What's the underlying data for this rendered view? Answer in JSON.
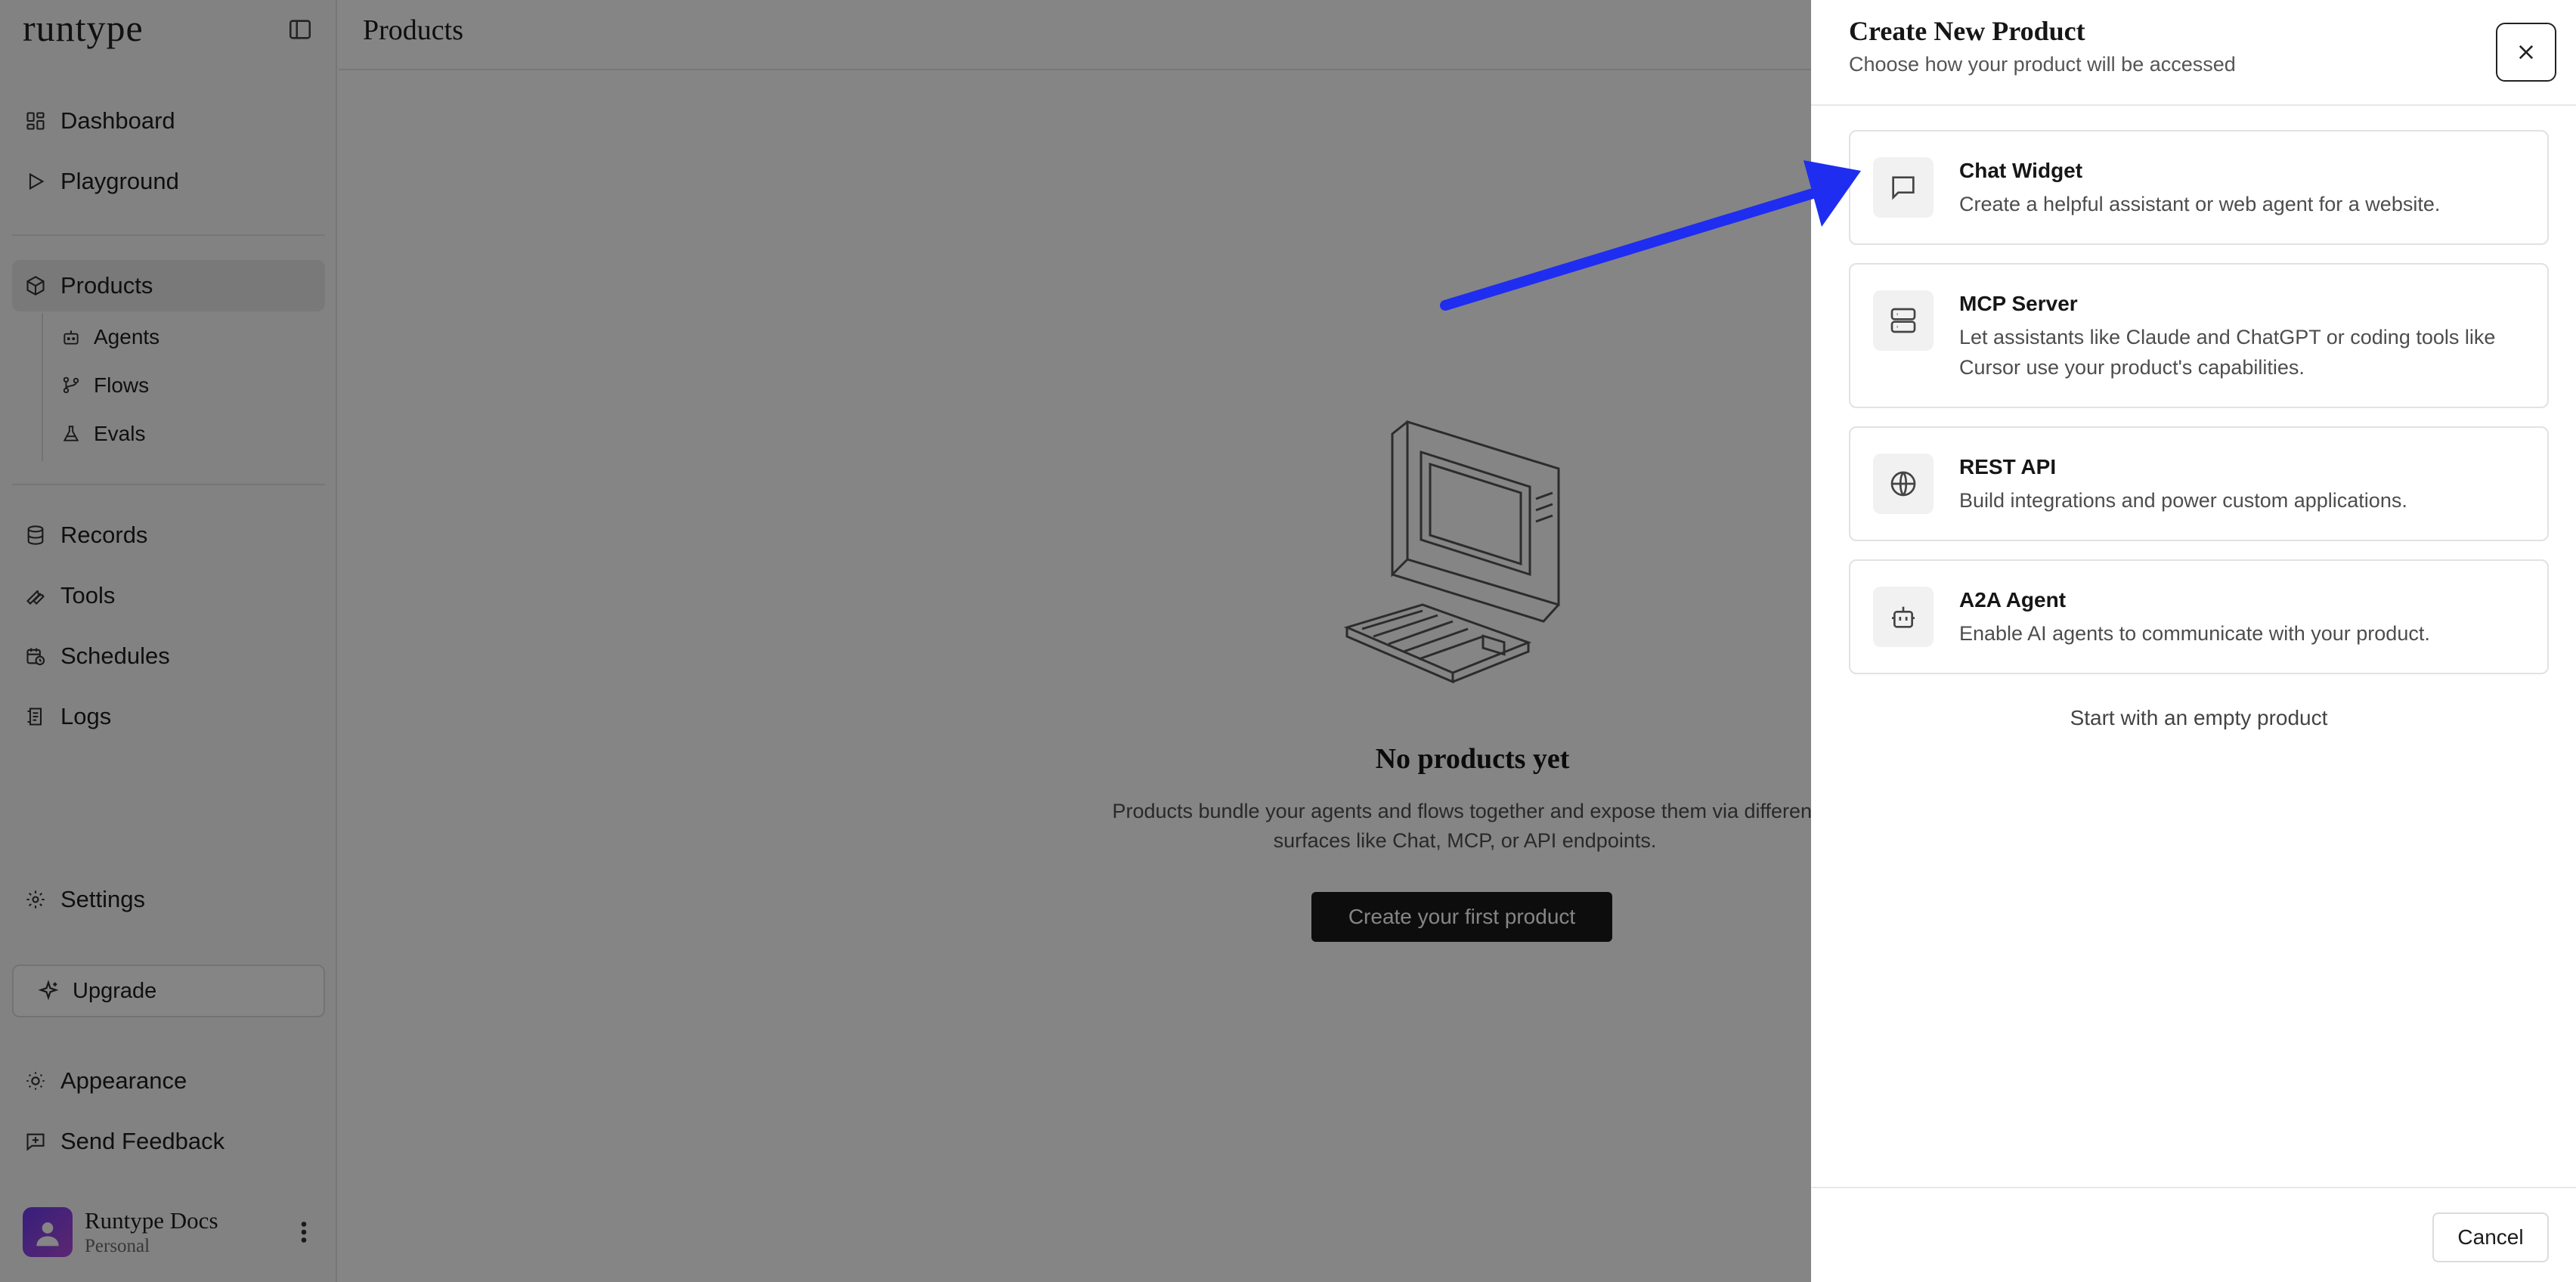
{
  "app": {
    "logo": "runtype"
  },
  "sidebar": {
    "items": [
      {
        "label": "Dashboard",
        "icon": "dashboard-icon"
      },
      {
        "label": "Playground",
        "icon": "play-icon"
      },
      {
        "label": "Products",
        "icon": "box-icon",
        "active": true
      },
      {
        "label": "Records",
        "icon": "database-icon"
      },
      {
        "label": "Tools",
        "icon": "wrench-icon"
      },
      {
        "label": "Schedules",
        "icon": "calendar-clock-icon"
      },
      {
        "label": "Logs",
        "icon": "logs-icon"
      },
      {
        "label": "Settings",
        "icon": "gear-icon"
      }
    ],
    "sub_items": [
      {
        "label": "Agents",
        "icon": "bot-icon"
      },
      {
        "label": "Flows",
        "icon": "git-branch-icon"
      },
      {
        "label": "Evals",
        "icon": "flask-icon"
      }
    ],
    "upgrade_label": "Upgrade",
    "appearance_label": "Appearance",
    "feedback_label": "Send Feedback",
    "user": {
      "name": "Runtype Docs",
      "plan": "Personal"
    }
  },
  "main": {
    "title": "Products",
    "empty_state": {
      "title": "No products yet",
      "description": "Products bundle your agents and flows together and expose them via different surfaces like Chat, MCP, or API endpoints.",
      "cta": "Create your first product"
    }
  },
  "drawer": {
    "title": "Create New Product",
    "subtitle": "Choose how your product will be accessed",
    "options": [
      {
        "title": "Chat Widget",
        "description": "Create a helpful assistant or web agent for a website.",
        "icon": "message-square-icon"
      },
      {
        "title": "MCP Server",
        "description": "Let assistants like Claude and ChatGPT or coding tools like Cursor use your product's capabilities.",
        "icon": "server-icon"
      },
      {
        "title": "REST API",
        "description": "Build integrations and power custom applications.",
        "icon": "globe-icon"
      },
      {
        "title": "A2A Agent",
        "description": "Enable AI agents to communicate with your product.",
        "icon": "bot-icon"
      }
    ],
    "empty_option": "Start with an empty product",
    "cancel_label": "Cancel"
  },
  "colors": {
    "annotation_arrow": "#1f2df0",
    "overlay": "#000000",
    "avatar": "#7b3ff0"
  }
}
